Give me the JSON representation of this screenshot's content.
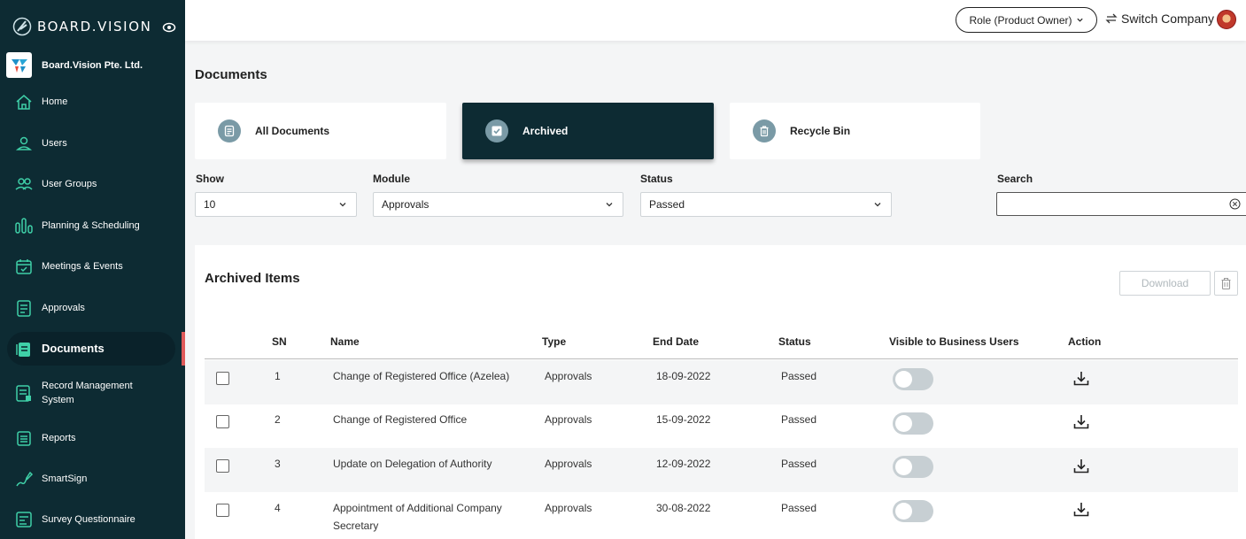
{
  "app": {
    "brand": "BOARD.VISION",
    "company": "Board.Vision Pte. Ltd."
  },
  "sidebar": {
    "items": [
      {
        "label": "Home",
        "icon": "home-icon"
      },
      {
        "label": "Users",
        "icon": "user-icon"
      },
      {
        "label": "User Groups",
        "icon": "user-groups-icon"
      },
      {
        "label": "Planning & Scheduling",
        "icon": "bar-chart-icon"
      },
      {
        "label": "Meetings & Events",
        "icon": "calendar-icon"
      },
      {
        "label": "Approvals",
        "icon": "approval-document-icon"
      },
      {
        "label": "Documents",
        "icon": "documents-icon",
        "active": true
      },
      {
        "label": "Record Management System",
        "icon": "record-management-icon"
      },
      {
        "label": "Reports",
        "icon": "reports-icon"
      },
      {
        "label": "SmartSign",
        "icon": "pen-sign-icon"
      },
      {
        "label": "Survey Questionnaire",
        "icon": "survey-icon"
      }
    ]
  },
  "header": {
    "role": "Role (Product Owner)",
    "switch_company": "Switch Company"
  },
  "page": {
    "title": "Documents"
  },
  "tabs": [
    {
      "label": "All Documents",
      "icon": "document-icon"
    },
    {
      "label": "Archived",
      "icon": "checkbox-icon",
      "active": true
    },
    {
      "label": "Recycle Bin",
      "icon": "trash-icon"
    }
  ],
  "filters": {
    "show": {
      "label": "Show",
      "value": "10"
    },
    "module": {
      "label": "Module",
      "value": "Approvals"
    },
    "status": {
      "label": "Status",
      "value": "Passed"
    },
    "search": {
      "label": "Search",
      "value": ""
    }
  },
  "archived": {
    "title": "Archived Items",
    "download_label": "Download",
    "columns": {
      "sn": "SN",
      "name": "Name",
      "type": "Type",
      "end_date": "End Date",
      "status": "Status",
      "visible": "Visible to Business Users",
      "action": "Action"
    },
    "rows": [
      {
        "sn": "1",
        "name": "Change of Registered Office (Azelea)",
        "type": "Approvals",
        "end_date": "18-09-2022",
        "status": "Passed",
        "visible": false
      },
      {
        "sn": "2",
        "name": "Change of Registered Office",
        "type": "Approvals",
        "end_date": "15-09-2022",
        "status": "Passed",
        "visible": false
      },
      {
        "sn": "3",
        "name": "Update on Delegation of Authority",
        "type": "Approvals",
        "end_date": "12-09-2022",
        "status": "Passed",
        "visible": false
      },
      {
        "sn": "4",
        "name": "Appointment of Additional Company Secretary",
        "type": "Approvals",
        "end_date": "30-08-2022",
        "status": "Passed",
        "visible": false
      }
    ]
  },
  "colors": {
    "sidebar": "#0d2b33",
    "active_tab": "#0d2b33",
    "accent_bar": "#e05a5a",
    "icon_green": "#3fd0a8"
  }
}
